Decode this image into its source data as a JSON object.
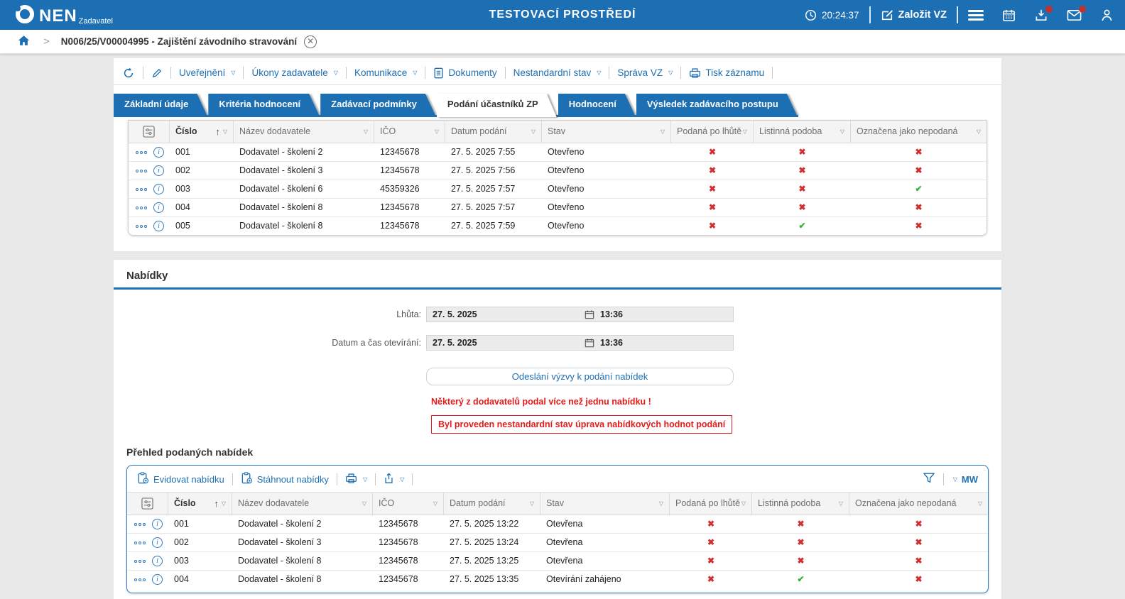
{
  "theme": {
    "accent": "#1d6fb3",
    "warning_red": "#e41b1b",
    "cross_red": "#d02f2f",
    "check_green": "#35b235",
    "page_bg": "#e8e8e8"
  },
  "header": {
    "logo": "NEN",
    "logo_sub": "Zadavatel",
    "env_title": "TESTOVACÍ PROSTŘEDÍ",
    "time": "20:24:37",
    "create_vz": "Založit VZ",
    "icons": [
      "clock-icon",
      "edit-icon",
      "menu-icon",
      "calendar-icon",
      "inbox-icon",
      "mail-icon",
      "user-icon"
    ]
  },
  "breadcrumb": {
    "record": "N006/25/V00004995 - Zajištění závodního stravování",
    "icons": [
      "home-icon",
      "close-icon"
    ]
  },
  "record_toolbar": {
    "icons": [
      "refresh-icon",
      "pencil-icon"
    ],
    "uverejneni": "Uveřejnění",
    "ukony": "Úkony zadavatele",
    "komunikace": "Komunikace",
    "dokumenty": "Dokumenty",
    "nestandardni": "Nestandardní stav",
    "sprava": "Správa VZ",
    "tisk": "Tisk záznamu"
  },
  "tabs": {
    "items": [
      {
        "label": "Základní údaje",
        "active": false
      },
      {
        "label": "Kritéria hodnocení",
        "active": false
      },
      {
        "label": "Zadávací podmínky",
        "active": false
      },
      {
        "label": "Podání účastníků ZP",
        "active": true
      },
      {
        "label": "Hodnocení",
        "active": false
      },
      {
        "label": "Výsledek zadávacího postupu",
        "active": false
      }
    ]
  },
  "participants_table": {
    "columns": [
      "Číslo",
      "Název dodavatele",
      "IČO",
      "Datum podání",
      "Stav",
      "Podaná po lhůtě",
      "Listinná podoba",
      "Označena jako nepodaná"
    ],
    "sort_column": "Číslo",
    "sort_direction": "asc",
    "rows": [
      {
        "cislo": "001",
        "dodavatel": "Dodavatel - školení 2",
        "ico": "12345678",
        "datum_podani": "27. 5. 2025 7:55",
        "stav": "Otevřeno",
        "podana_po_lhute": false,
        "listinna_podoba": false,
        "oznacena_nepodana": false
      },
      {
        "cislo": "002",
        "dodavatel": "Dodavatel - školení 3",
        "ico": "12345678",
        "datum_podani": "27. 5. 2025 7:56",
        "stav": "Otevřeno",
        "podana_po_lhute": false,
        "listinna_podoba": false,
        "oznacena_nepodana": false
      },
      {
        "cislo": "003",
        "dodavatel": "Dodavatel - školení 6",
        "ico": "45359326",
        "datum_podani": "27. 5. 2025 7:57",
        "stav": "Otevřeno",
        "podana_po_lhute": false,
        "listinna_podoba": false,
        "oznacena_nepodana": true
      },
      {
        "cislo": "004",
        "dodavatel": "Dodavatel - školení 8",
        "ico": "12345678",
        "datum_podani": "27. 5. 2025 7:57",
        "stav": "Otevřeno",
        "podana_po_lhute": false,
        "listinna_podoba": false,
        "oznacena_nepodana": false
      },
      {
        "cislo": "005",
        "dodavatel": "Dodavatel - školení 8",
        "ico": "12345678",
        "datum_podani": "27. 5. 2025 7:59",
        "stav": "Otevřeno",
        "podana_po_lhute": false,
        "listinna_podoba": true,
        "oznacena_nepodana": false
      }
    ]
  },
  "nabidky": {
    "title": "Nabídky",
    "lhuta_label": "Lhůta:",
    "lhuta_date": "27. 5. 2025",
    "lhuta_time": "13:36",
    "oteviranie_label": "Datum a čas otevírání:",
    "oteviranie_date": "27. 5. 2025",
    "oteviranie_time": "13:36",
    "send_button": "Odeslání výzvy k podání nabídek",
    "warning_multiple": "Některý z dodavatelů podal více než jednu nabídku !",
    "warning_nonstandard": "Byl proveden nestandardní stav úprava nabídkových hodnot podání"
  },
  "offers": {
    "title": "Přehled podaných nabídek",
    "toolbar": {
      "evidovat": "Evidovat nabídku",
      "stahnout": "Stáhnout nabídky",
      "mw": "MW",
      "icons": [
        "clipboard-add-icon",
        "clipboard-download-icon",
        "printer-icon",
        "share-icon",
        "filter-icon"
      ]
    },
    "columns": [
      "Číslo",
      "Název dodavatele",
      "IČO",
      "Datum podání",
      "Stav",
      "Podaná po lhůtě",
      "Listinná podoba",
      "Označena jako nepodaná"
    ],
    "sort_column": "Číslo",
    "sort_direction": "asc",
    "rows": [
      {
        "cislo": "001",
        "dodavatel": "Dodavatel - školení 2",
        "ico": "12345678",
        "datum_podani": "27. 5. 2025 13:22",
        "stav": "Otevřena",
        "podana_po_lhute": false,
        "listinna_podoba": false,
        "oznacena_nepodana": false
      },
      {
        "cislo": "002",
        "dodavatel": "Dodavatel - školení 3",
        "ico": "12345678",
        "datum_podani": "27. 5. 2025 13:24",
        "stav": "Otevřena",
        "podana_po_lhute": false,
        "listinna_podoba": false,
        "oznacena_nepodana": false
      },
      {
        "cislo": "003",
        "dodavatel": "Dodavatel - školení 8",
        "ico": "12345678",
        "datum_podani": "27. 5. 2025 13:25",
        "stav": "Otevřena",
        "podana_po_lhute": false,
        "listinna_podoba": false,
        "oznacena_nepodana": false
      },
      {
        "cislo": "004",
        "dodavatel": "Dodavatel - školení 8",
        "ico": "12345678",
        "datum_podani": "27. 5. 2025 13:35",
        "stav": "Otevírání zahájeno",
        "podana_po_lhute": false,
        "listinna_podoba": true,
        "oznacena_nepodana": false
      }
    ]
  }
}
